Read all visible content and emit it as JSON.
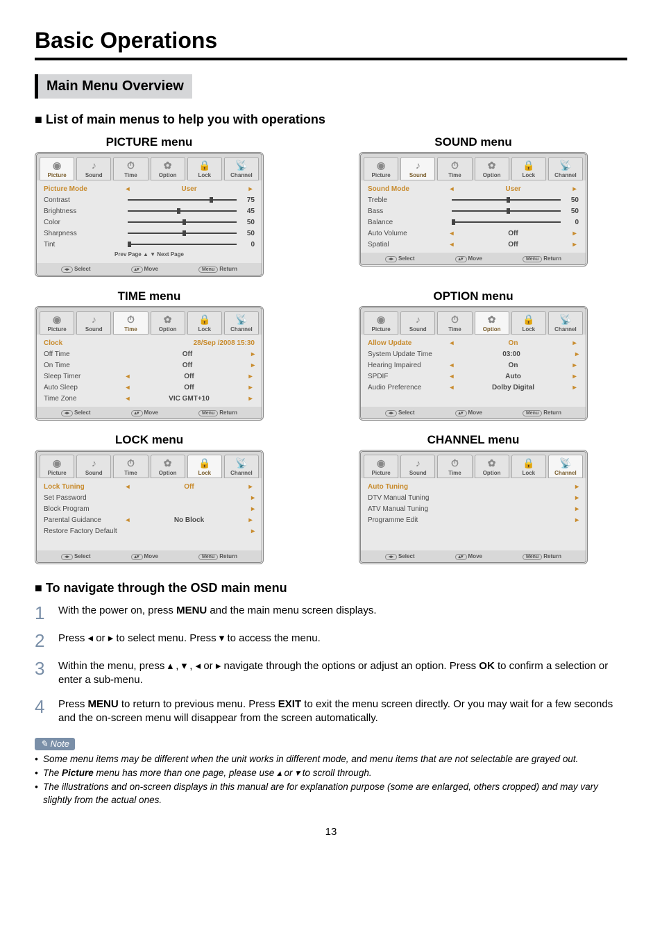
{
  "page_title": "Basic Operations",
  "section_title": "Main Menu Overview",
  "list_heading": "List of main menus to help you with operations",
  "nav_heading": "To navigate through the OSD main menu",
  "tabs": [
    "Picture",
    "Sound",
    "Time",
    "Option",
    "Lock",
    "Channel"
  ],
  "footer": {
    "select": "Select",
    "move": "Move",
    "return": "Return",
    "menu_key": "Menu"
  },
  "picture": {
    "title": "PICTURE menu",
    "rows": [
      {
        "label": "Picture Mode",
        "type": "arrow",
        "value": "User",
        "active": true
      },
      {
        "label": "Contrast",
        "type": "slider",
        "value": 75
      },
      {
        "label": "Brightness",
        "type": "slider",
        "value": 45
      },
      {
        "label": "Color",
        "type": "slider",
        "value": 50
      },
      {
        "label": "Sharpness",
        "type": "slider",
        "value": 50
      },
      {
        "label": "Tint",
        "type": "slider",
        "value": 0
      }
    ],
    "pager": "Prev Page ▲  ▼ Next Page"
  },
  "sound": {
    "title": "SOUND menu",
    "rows": [
      {
        "label": "Sound Mode",
        "type": "arrow",
        "value": "User",
        "active": true
      },
      {
        "label": "Treble",
        "type": "slider",
        "value": 50
      },
      {
        "label": "Bass",
        "type": "slider",
        "value": 50
      },
      {
        "label": "Balance",
        "type": "slider",
        "value": 0
      },
      {
        "label": "Auto Volume",
        "type": "arrow",
        "value": "Off"
      },
      {
        "label": "Spatial",
        "type": "arrow",
        "value": "Off"
      }
    ]
  },
  "time": {
    "title": "TIME menu",
    "rows": [
      {
        "label": "Clock",
        "type": "text",
        "value": "28/Sep /2008 15:30",
        "active": true
      },
      {
        "label": "Off Time",
        "type": "chev",
        "value": "Off"
      },
      {
        "label": "On Time",
        "type": "chev",
        "value": "Off"
      },
      {
        "label": "Sleep Timer",
        "type": "arrow",
        "value": "Off"
      },
      {
        "label": "Auto Sleep",
        "type": "arrow",
        "value": "Off"
      },
      {
        "label": "Time Zone",
        "type": "arrow",
        "value": "VIC GMT+10"
      }
    ]
  },
  "option": {
    "title": "OPTION menu",
    "rows": [
      {
        "label": "Allow Update",
        "type": "arrowL",
        "value": "On",
        "active": true
      },
      {
        "label": "System Update Time",
        "type": "chev",
        "value": "03:00"
      },
      {
        "label": "Hearing Impaired",
        "type": "arrow",
        "value": "On"
      },
      {
        "label": "SPDIF",
        "type": "arrow",
        "value": "Auto"
      },
      {
        "label": "Audio Preference",
        "type": "arrow",
        "value": "Dolby Digital"
      }
    ]
  },
  "lock": {
    "title": "LOCK menu",
    "rows": [
      {
        "label": "Lock Tuning",
        "type": "arrowL",
        "value": "Off",
        "active": true
      },
      {
        "label": "Set Password",
        "type": "chevonly"
      },
      {
        "label": "Block Program",
        "type": "chevonly"
      },
      {
        "label": "Parental Guidance",
        "type": "arrowL",
        "value": "No Block"
      },
      {
        "label": "Restore Factory Default",
        "type": "chevonly"
      }
    ]
  },
  "channel": {
    "title": "CHANNEL menu",
    "rows": [
      {
        "label": "Auto Tuning",
        "type": "chevonly",
        "active": true
      },
      {
        "label": "DTV Manual Tuning",
        "type": "chevonly"
      },
      {
        "label": "ATV Manual Tuning",
        "type": "chevonly"
      },
      {
        "label": "Programme Edit",
        "type": "chevonly"
      }
    ]
  },
  "steps": [
    "With the power on, press MENU and the main menu screen displays.",
    "Press ◂ or ▸ to select menu.  Press ▾ to access the menu.",
    "Within the menu, press ▴ , ▾ , ◂ or ▸ navigate through the options or adjust an option. Press OK to confirm a selection or enter a sub-menu.",
    "Press MENU to return to previous menu. Press EXIT to exit the menu screen directly. Or you may wait for a few seconds and the on-screen menu will disappear from the screen automatically."
  ],
  "note_label": "Note",
  "notes": [
    "Some menu items may be different when the unit works in different mode, and menu items that are not selectable are grayed out.",
    "The Picture menu has more than one page, please use ▴ or ▾ to scroll through.",
    "The illustrations and on-screen displays in this manual are for explanation purpose (some are enlarged, others cropped) and may vary slightly from the actual ones."
  ],
  "page_number": "13"
}
